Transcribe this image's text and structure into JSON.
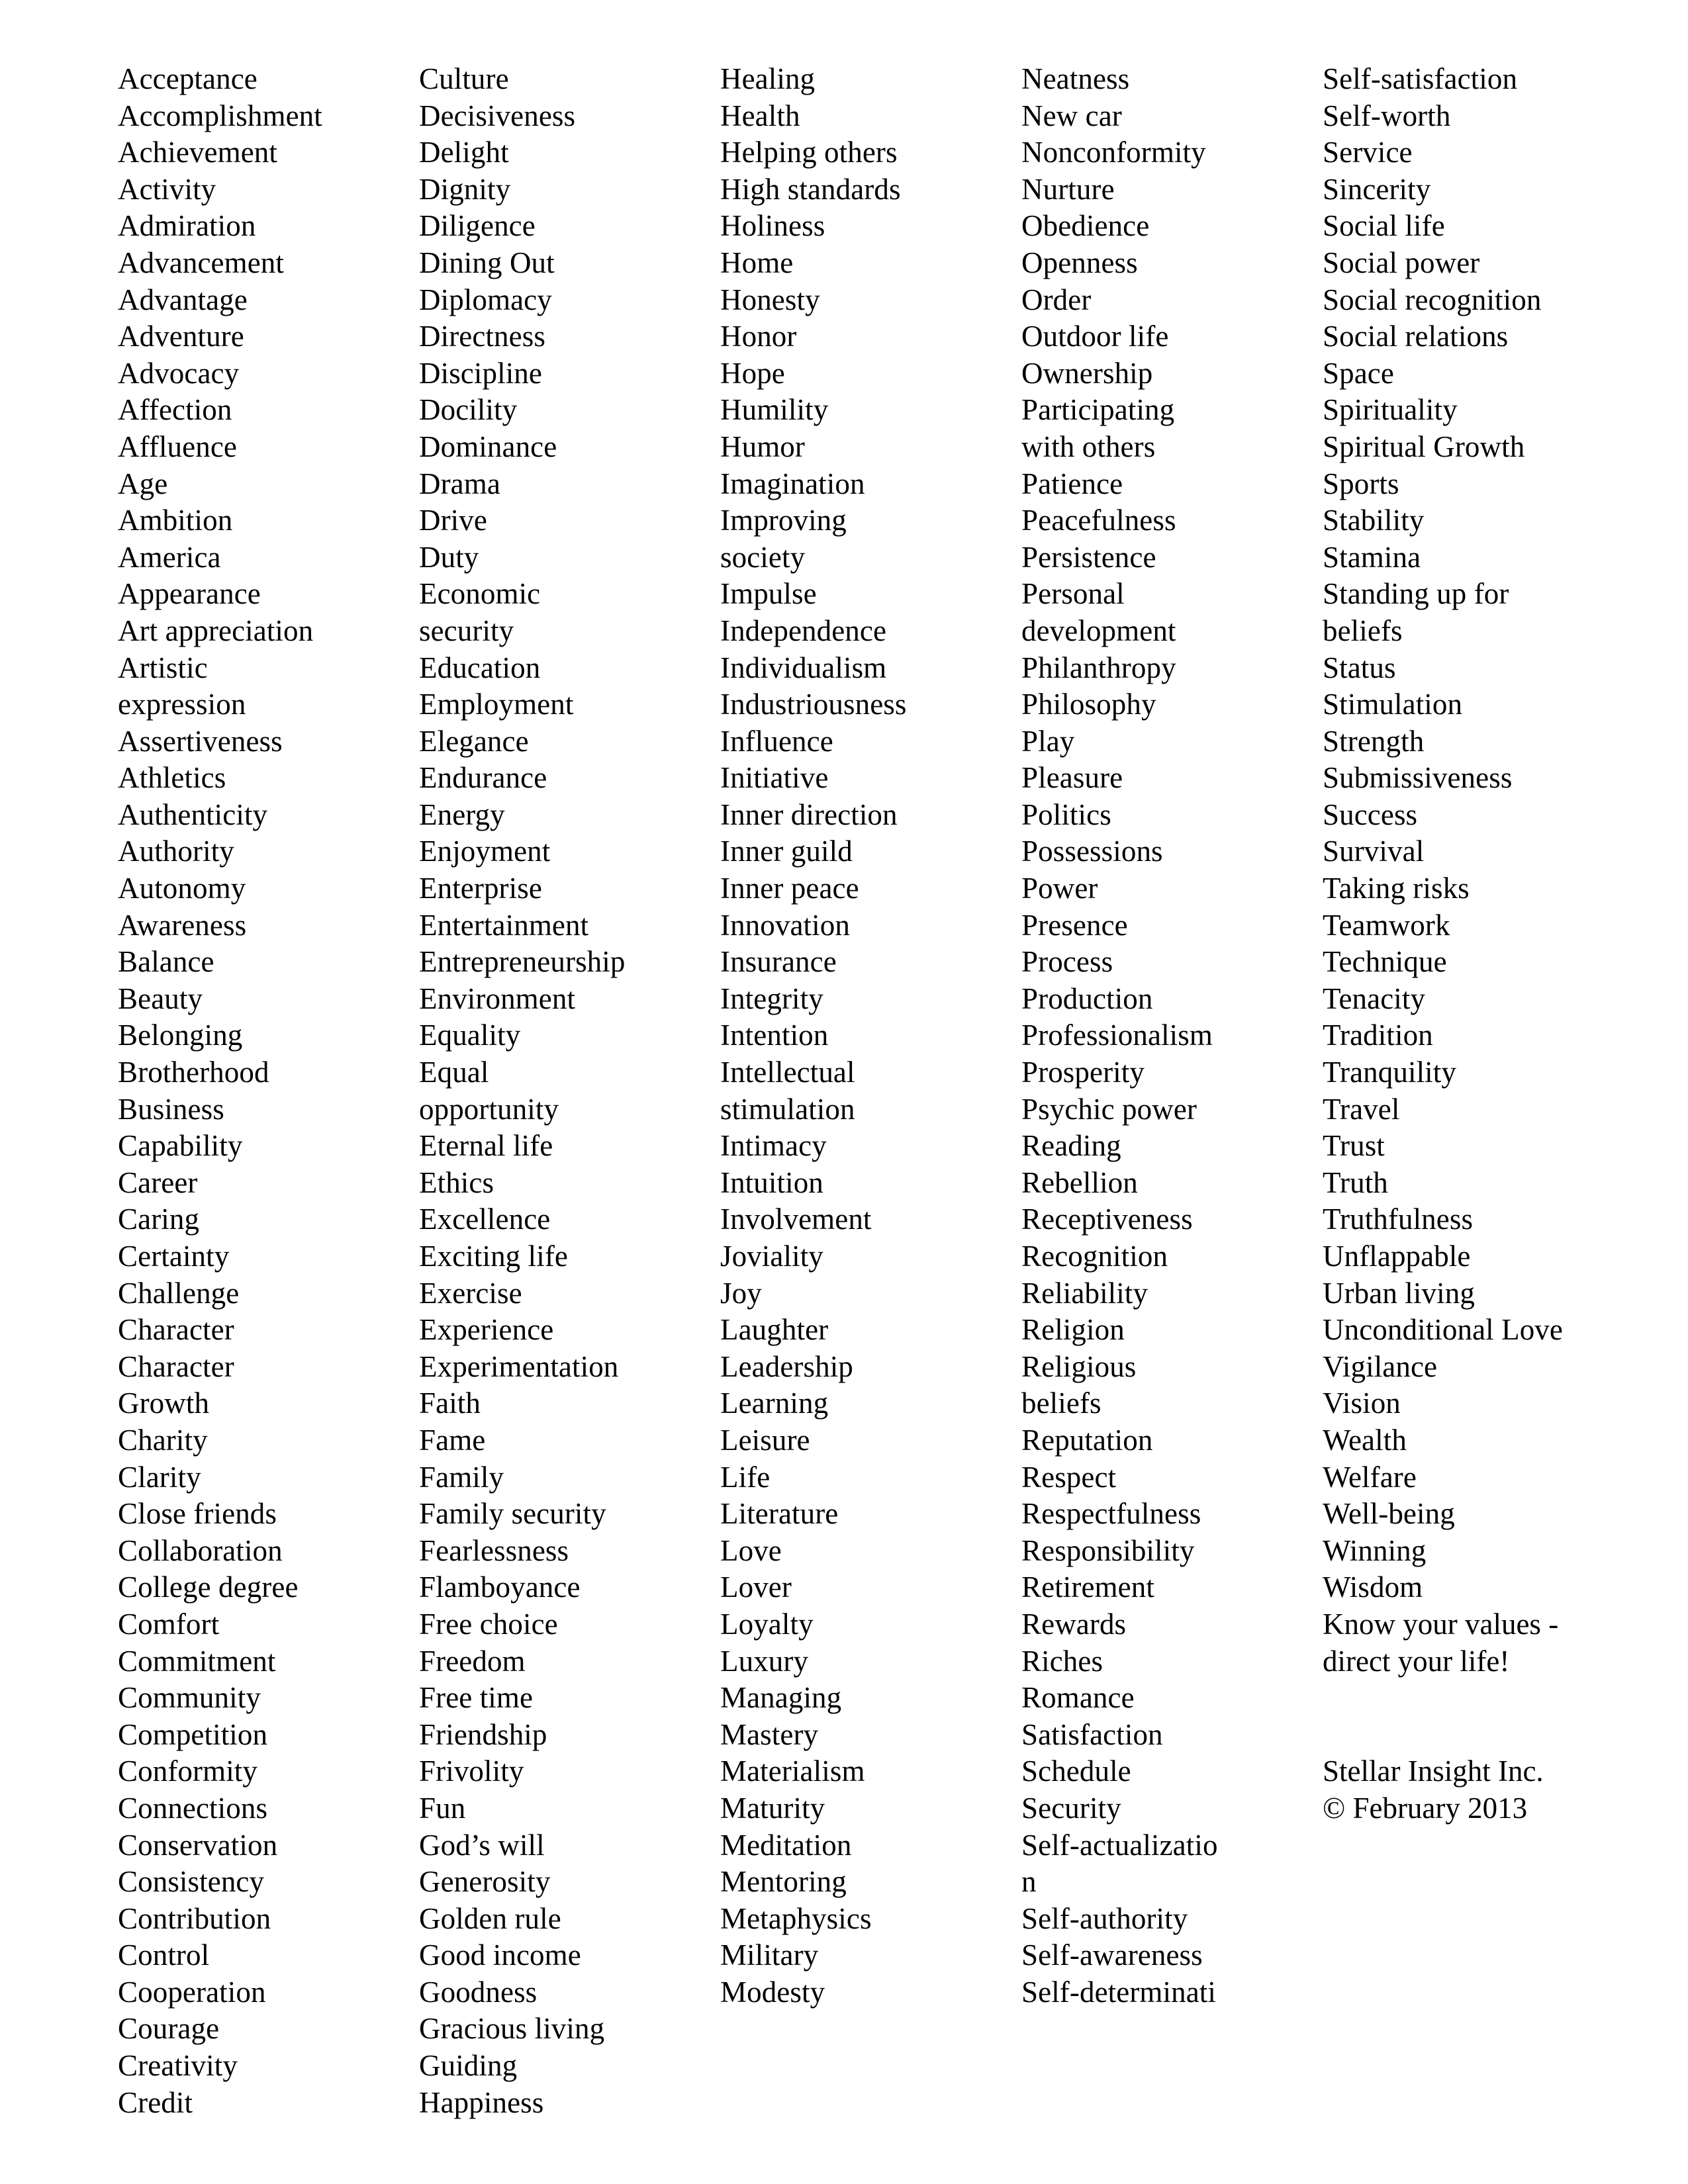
{
  "document": {
    "type": "values-list-worksheet",
    "column_count": 5
  },
  "columns": [
    {
      "id": "column-1",
      "entries": [
        "Acceptance",
        "Accomplishment",
        "Achievement",
        "Activity",
        "Admiration",
        "Advancement",
        "Advantage",
        "Adventure",
        "Advocacy",
        "Affection",
        "Affluence",
        "Age",
        "Ambition",
        "America",
        "Appearance",
        "Art appreciation",
        "Artistic",
        "expression",
        "Assertiveness",
        "Athletics",
        "Authenticity",
        "Authority",
        "Autonomy",
        "Awareness",
        "Balance",
        "Beauty",
        "Belonging",
        "Brotherhood",
        "Business",
        "Capability",
        "Career",
        "Caring",
        "Certainty",
        "Challenge",
        "Character",
        "Character",
        "Growth",
        "Charity",
        "Clarity",
        "Close friends",
        "Collaboration",
        "College degree",
        "Comfort",
        "Commitment",
        "Community",
        "Competition",
        "Conformity",
        "Connections",
        "Conservation",
        "Consistency",
        "Contribution",
        "Control",
        "Cooperation",
        "Courage",
        "Creativity",
        "Credit"
      ]
    },
    {
      "id": "column-2",
      "entries": [
        "Culture",
        "Decisiveness",
        "Delight",
        "Dignity",
        "Diligence",
        "Dining Out",
        "Diplomacy",
        "Directness",
        "Discipline",
        "Docility",
        "Dominance",
        "Drama",
        "Drive",
        "Duty",
        "Economic",
        "security",
        "Education",
        "Employment",
        "Elegance",
        "Endurance",
        "Energy",
        "Enjoyment",
        "Enterprise",
        "Entertainment",
        "Entrepreneurship",
        "Environment",
        "Equality",
        "Equal",
        "opportunity",
        "Eternal life",
        "Ethics",
        "Excellence",
        "Exciting life",
        "Exercise",
        "Experience",
        "Experimentation",
        "Faith",
        "Fame",
        "Family",
        "Family security",
        "Fearlessness",
        "Flamboyance",
        "Free choice",
        "Freedom",
        "Free time",
        "Friendship",
        "Frivolity",
        "Fun",
        "God’s will",
        "Generosity",
        "Golden rule",
        "Good income",
        "Goodness",
        "Gracious living",
        "Guiding",
        "Happiness"
      ]
    },
    {
      "id": "column-3",
      "entries": [
        "Healing",
        "Health",
        "Helping others",
        "High standards",
        "Holiness",
        "Home",
        "Honesty",
        "Honor",
        "Hope",
        "Humility",
        "Humor",
        "Imagination",
        "Improving",
        "society",
        "Impulse",
        "Independence",
        "Individualism",
        "Industriousness",
        "Influence",
        "Initiative",
        "Inner direction",
        "Inner guild",
        "Inner peace",
        "Innovation",
        "Insurance",
        "Integrity",
        "Intention",
        "Intellectual",
        "stimulation",
        "Intimacy",
        "Intuition",
        "Involvement",
        "Joviality",
        "Joy",
        "Laughter",
        "Leadership",
        "Learning",
        "Leisure",
        "Life",
        "Literature",
        "Love",
        "Lover",
        "Loyalty",
        "Luxury",
        "Managing",
        "Mastery",
        "Materialism",
        "Maturity",
        "Meditation",
        "Mentoring",
        "Metaphysics",
        "Military",
        "Modesty"
      ]
    },
    {
      "id": "column-4",
      "entries": [
        "Neatness",
        "New car",
        "Nonconformity",
        "Nurture",
        "Obedience",
        "Openness",
        "Order",
        "Outdoor life",
        "Ownership",
        "Participating",
        "with others",
        "Patience",
        "Peacefulness",
        "Persistence",
        "Personal",
        "development",
        "Philanthropy",
        "Philosophy",
        "Play",
        "Pleasure",
        "Politics",
        "Possessions",
        "Power",
        "Presence",
        "Process",
        "Production",
        "Professionalism",
        "Prosperity",
        "Psychic power",
        "Reading",
        "Rebellion",
        "Receptiveness",
        "Recognition",
        "Reliability",
        "Religion",
        "Religious",
        "beliefs",
        "Reputation",
        "Respect",
        "Respectfulness",
        "Responsibility",
        "Retirement",
        "Rewards",
        "Riches",
        "Romance",
        "Satisfaction",
        "Schedule",
        "Security",
        "Self-actualizatio",
        "n",
        "Self-authority",
        "Self-awareness",
        "Self-determinati"
      ]
    },
    {
      "id": "column-5",
      "entries": [
        "Self-satisfaction",
        "Self-worth",
        "Service",
        "Sincerity",
        "Social life",
        "Social power",
        "Social recognition",
        "Social relations",
        "Space",
        "Spirituality",
        "Spiritual Growth",
        "Sports",
        "Stability",
        "Stamina",
        "Standing up for",
        "beliefs",
        "Status",
        "Stimulation",
        "Strength",
        "Submissiveness",
        "Success",
        "Survival",
        "Taking risks",
        "Teamwork",
        "Technique",
        "Tenacity",
        "Tradition",
        "Tranquility",
        "Travel",
        "Trust",
        "Truth",
        "Truthfulness",
        "Unflappable",
        "Urban living",
        "Unconditional Love",
        "Vigilance",
        "Vision",
        "Wealth",
        "Welfare",
        "Well-being",
        "Winning",
        "Wisdom"
      ],
      "tagline": "Know your values - direct your life!",
      "footer": {
        "company": "Stellar Insight Inc.",
        "copyright": "© February 2013"
      }
    }
  ]
}
